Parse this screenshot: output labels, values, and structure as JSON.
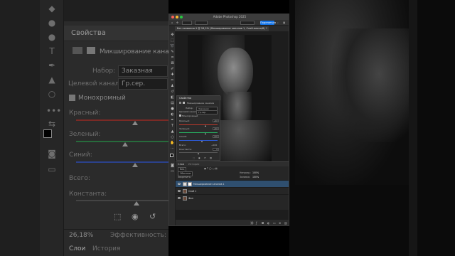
{
  "background_left": {
    "panel_title": "Свойства",
    "layer_label": "Микширование канал",
    "preset_label": "Набор:",
    "preset_value": "Заказная",
    "output_label": "Целевой канал:",
    "output_value": "Гр.сер.",
    "mono_label": "Монохромный",
    "red_label": "Красный:",
    "green_label": "Зеленый:",
    "blue_label": "Синий:",
    "total_label": "Всего:",
    "constant_label": "Константа:",
    "zoom": "26,18%",
    "efficiency": "Эффективность:",
    "tab_layers": "Слои",
    "tab_history": "История"
  },
  "window": {
    "title": "Adobe Photoshop 2025",
    "document_tab": "Без названия-1 @ 26,2% (Микширование каналов 1, Слой-маска/8) *",
    "share_label": "Поделиться"
  },
  "properties": {
    "title": "Свойства",
    "layer_label": "Микширование каналов",
    "preset_label": "Набор:",
    "preset_value": "Заказная",
    "output_label": "Целевой канал:",
    "output_value": "Гр.сер.",
    "mono_label": "Монохромный",
    "red_label": "Красный:",
    "red_value": "+40",
    "green_label": "Зеленый:",
    "green_value": "+40",
    "blue_label": "Синий:",
    "blue_value": "+20",
    "total_label": "Всего:",
    "total_value": "+100",
    "constant_label": "Константа:",
    "constant_value": "0"
  },
  "slider_levels": {
    "red": 0.7,
    "green": 0.7,
    "blue": 0.6,
    "constant": 0.5
  },
  "layers": {
    "tab_layers": "Слои",
    "tab_history": "История",
    "kind_label": "Вид",
    "blend_mode": "Обычные",
    "opacity_label": "Непрозр.:",
    "opacity_value": "100%",
    "lock_label": "Закрепить:",
    "fill_label": "Заливка:",
    "fill_value": "100%",
    "items": [
      {
        "name": "Микширование каналов 1",
        "selected": true
      },
      {
        "name": "Слой 1",
        "selected": false
      },
      {
        "name": "Фон",
        "selected": false
      }
    ]
  },
  "colors": {
    "accent": "#1473e6",
    "red_track": "#c0392b",
    "green_track": "#27ae60",
    "blue_track": "#2d5bd8"
  }
}
